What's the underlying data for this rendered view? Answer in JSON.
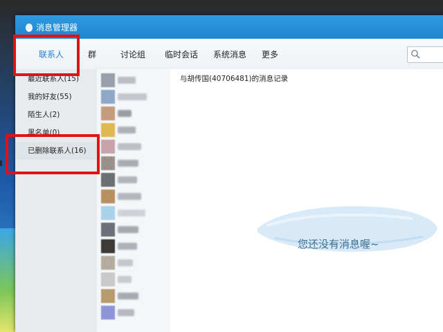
{
  "window": {
    "title": "消息管理器"
  },
  "toolbar": {
    "tabs": [
      {
        "label": "联系人",
        "active": true
      },
      {
        "label": "群"
      },
      {
        "label": "讨论组"
      },
      {
        "label": "临时会话"
      },
      {
        "label": "系统消息"
      },
      {
        "label": "更多"
      }
    ],
    "search_placeholder": ""
  },
  "sidebar": {
    "items": [
      {
        "label": "最近联系人(15)"
      },
      {
        "label": "我的好友(55)"
      },
      {
        "label": "陌生人(2)"
      },
      {
        "label": "黑名单(0)"
      },
      {
        "label": "已删除联系人(16)"
      }
    ]
  },
  "main": {
    "record_title": "与胡传国(40706481)的消息记录",
    "empty_text": "您还没有消息喔~"
  },
  "colors": {
    "titlebar": "#1f86d2",
    "active_tab": "#1f7fd4",
    "highlight": "#e01218"
  },
  "icons": {
    "title": "qq-penguin-icon",
    "search": "search-icon"
  }
}
